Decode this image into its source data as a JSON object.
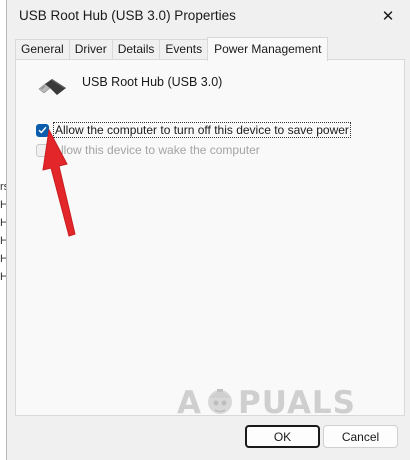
{
  "background_letters": [
    "rs",
    "H",
    "H",
    "H",
    "H",
    "H"
  ],
  "window": {
    "title": "USB Root Hub (USB 3.0) Properties",
    "close_glyph": "✕"
  },
  "tabs": [
    {
      "label": "General"
    },
    {
      "label": "Driver"
    },
    {
      "label": "Details"
    },
    {
      "label": "Events"
    },
    {
      "label": "Power Management",
      "active": true
    }
  ],
  "device": {
    "name": "USB Root Hub (USB 3.0)",
    "icon": "usb-connector-icon"
  },
  "options": [
    {
      "label": "Allow the computer to turn off this device to save power",
      "checked": true,
      "enabled": true
    },
    {
      "label": "Allow this device to wake the computer",
      "checked": false,
      "enabled": false
    }
  ],
  "watermark": {
    "before": "A",
    "after": "PUALS"
  },
  "buttons": {
    "ok": "OK",
    "cancel": "Cancel"
  },
  "colors": {
    "accent": "#0b5cad",
    "annotation_arrow": "#e3262a"
  }
}
